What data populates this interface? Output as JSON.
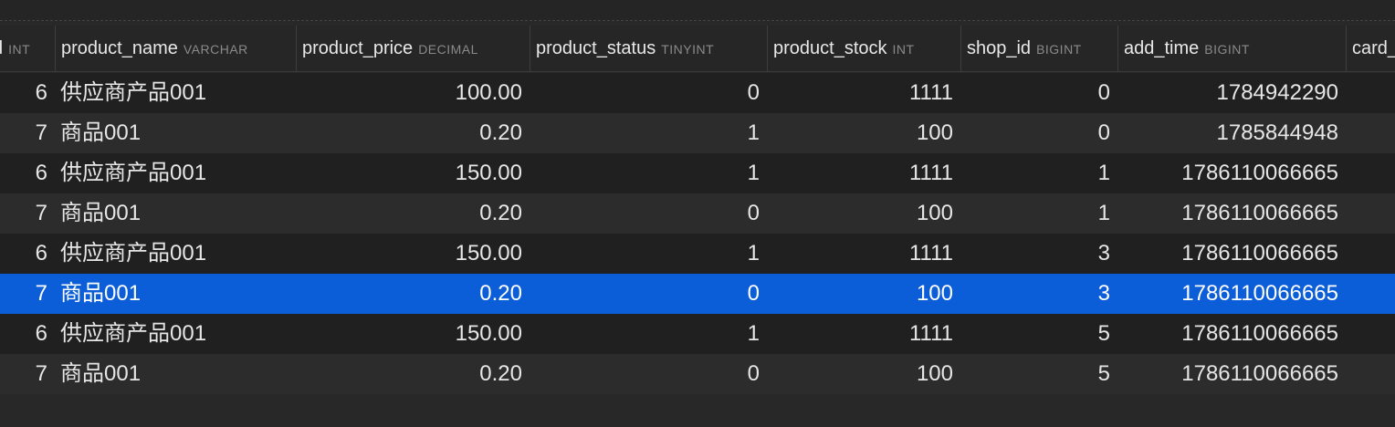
{
  "table": {
    "columns": [
      {
        "name": "d",
        "type": "INT"
      },
      {
        "name": "product_name",
        "type": "VARCHAR"
      },
      {
        "name": "product_price",
        "type": "DECIMAL"
      },
      {
        "name": "product_status",
        "type": "TINYINT"
      },
      {
        "name": "product_stock",
        "type": "INT"
      },
      {
        "name": "shop_id",
        "type": "BIGINT"
      },
      {
        "name": "add_time",
        "type": "BIGINT"
      },
      {
        "name": "card_",
        "type": ""
      }
    ],
    "rows": [
      {
        "id": "6",
        "product_name": "供应商产品001",
        "product_price": "100.00",
        "product_status": "0",
        "product_stock": "1111",
        "shop_id": "0",
        "add_time": "1784942290"
      },
      {
        "id": "7",
        "product_name": "商品001",
        "product_price": "0.20",
        "product_status": "1",
        "product_stock": "100",
        "shop_id": "0",
        "add_time": "1785844948"
      },
      {
        "id": "6",
        "product_name": "供应商产品001",
        "product_price": "150.00",
        "product_status": "1",
        "product_stock": "1111",
        "shop_id": "1",
        "add_time": "1786110066665"
      },
      {
        "id": "7",
        "product_name": "商品001",
        "product_price": "0.20",
        "product_status": "0",
        "product_stock": "100",
        "shop_id": "1",
        "add_time": "1786110066665"
      },
      {
        "id": "6",
        "product_name": "供应商产品001",
        "product_price": "150.00",
        "product_status": "1",
        "product_stock": "1111",
        "shop_id": "3",
        "add_time": "1786110066665"
      },
      {
        "id": "7",
        "product_name": "商品001",
        "product_price": "0.20",
        "product_status": "0",
        "product_stock": "100",
        "shop_id": "3",
        "add_time": "1786110066665"
      },
      {
        "id": "6",
        "product_name": "供应商产品001",
        "product_price": "150.00",
        "product_status": "1",
        "product_stock": "1111",
        "shop_id": "5",
        "add_time": "1786110066665"
      },
      {
        "id": "7",
        "product_name": "商品001",
        "product_price": "0.20",
        "product_status": "0",
        "product_stock": "100",
        "shop_id": "5",
        "add_time": "1786110066665"
      }
    ],
    "selected_row": 5,
    "colors": {
      "selection": "#0b5ed7",
      "row_odd": "#202020",
      "row_even": "#2c2c2c",
      "header_text": "#e8e8e8",
      "type_text": "#8a8a8a"
    }
  }
}
